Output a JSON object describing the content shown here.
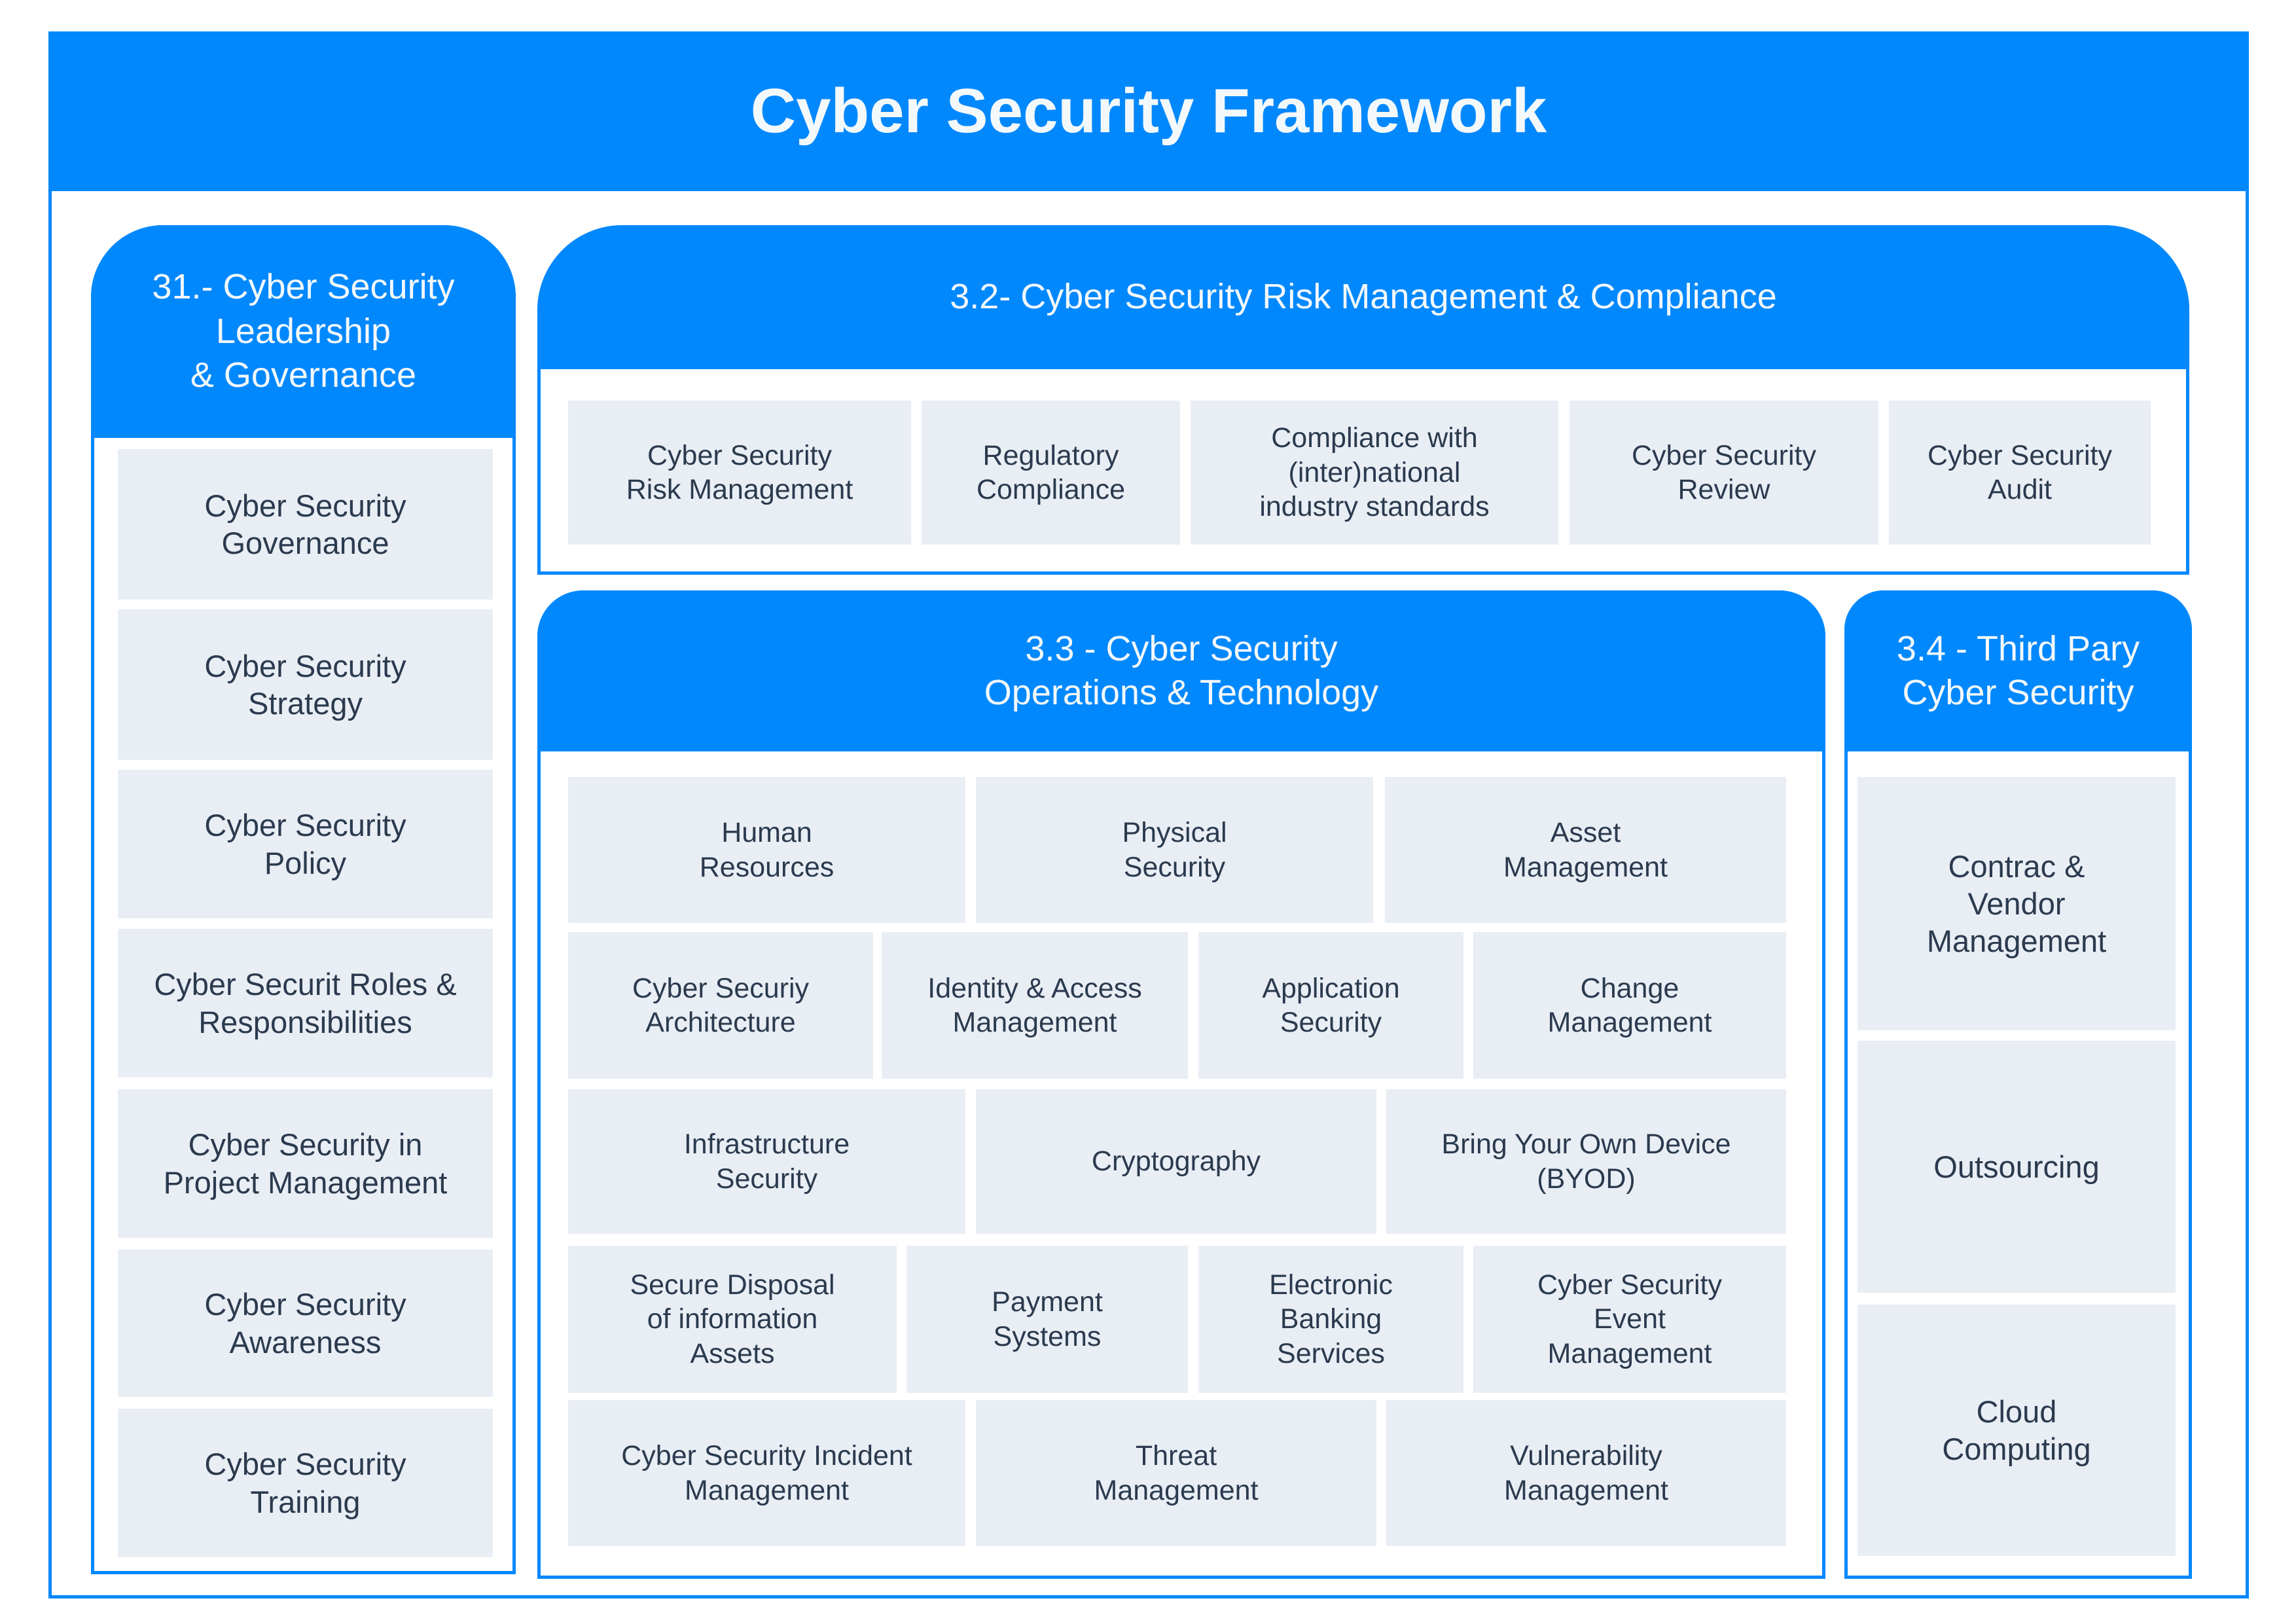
{
  "title": "Cyber Security Framework",
  "colors": {
    "accent": "#0288fd",
    "tile_bg": "#e9eef5",
    "tile_text": "#2b3a4e",
    "header_text": "#f3f8fb"
  },
  "sections": {
    "s31": {
      "title": "31.- Cyber Security\nLeadership\n& Governance",
      "items": [
        "Cyber Security\nGovernance",
        "Cyber Security\nStrategy",
        "Cyber Security\nPolicy",
        "Cyber Securit Roles &\nResponsibilities",
        "Cyber Security in\nProject Management",
        "Cyber Security\nAwareness",
        "Cyber Security\nTraining"
      ]
    },
    "s32": {
      "title": "3.2- Cyber Security Risk Management & Compliance",
      "items": [
        "Cyber Security\nRisk Management",
        "Regulatory\nCompliance",
        "Compliance with\n(inter)national\nindustry standards",
        "Cyber Security\nReview",
        "Cyber Security\nAudit"
      ]
    },
    "s33": {
      "title": "3.3 - Cyber Security\nOperations & Technology",
      "rows": [
        [
          "Human\nResources",
          "Physical\nSecurity",
          "Asset\nManagement"
        ],
        [
          "Cyber Securiy\nArchitecture",
          "Identity & Access\nManagement",
          "Application\nSecurity",
          "Change\nManagement"
        ],
        [
          "Infrastructure\nSecurity",
          "Cryptography",
          "Bring Your Own Device\n(BYOD)"
        ],
        [
          "Secure Disposal\nof information\nAssets",
          "Payment\nSystems",
          "Electronic\nBanking\nServices",
          "Cyber Security\nEvent\nManagement"
        ],
        [
          "Cyber Security Incident\nManagement",
          "Threat\nManagement",
          "Vulnerability\nManagement"
        ]
      ]
    },
    "s34": {
      "title": "3.4 - Third Pary\nCyber Security",
      "items": [
        "Contrac &\nVendor\nManagement",
        "Outsourcing",
        "Cloud\nComputing"
      ]
    }
  }
}
